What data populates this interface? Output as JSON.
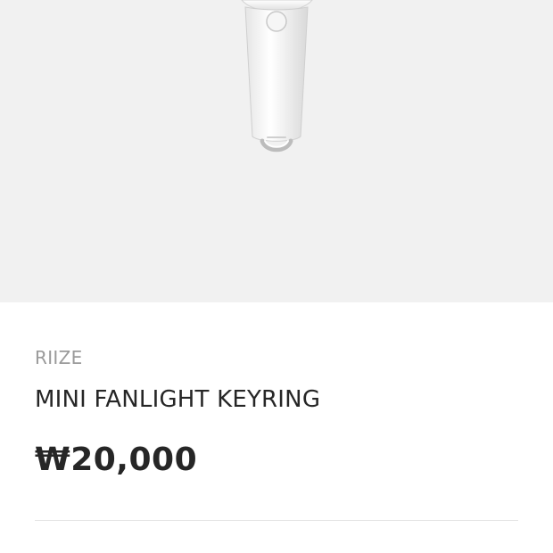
{
  "product": {
    "brand": "RIIZE",
    "title": "MINI FANLIGHT KEYRING",
    "price": "₩20,000",
    "image": "product-image-keyring"
  },
  "colors": {
    "image_background": "#f1f1f1",
    "page_background": "#ffffff",
    "brand_text": "#9a9a9a",
    "primary_text": "#262626",
    "divider": "#e4e4e4"
  }
}
